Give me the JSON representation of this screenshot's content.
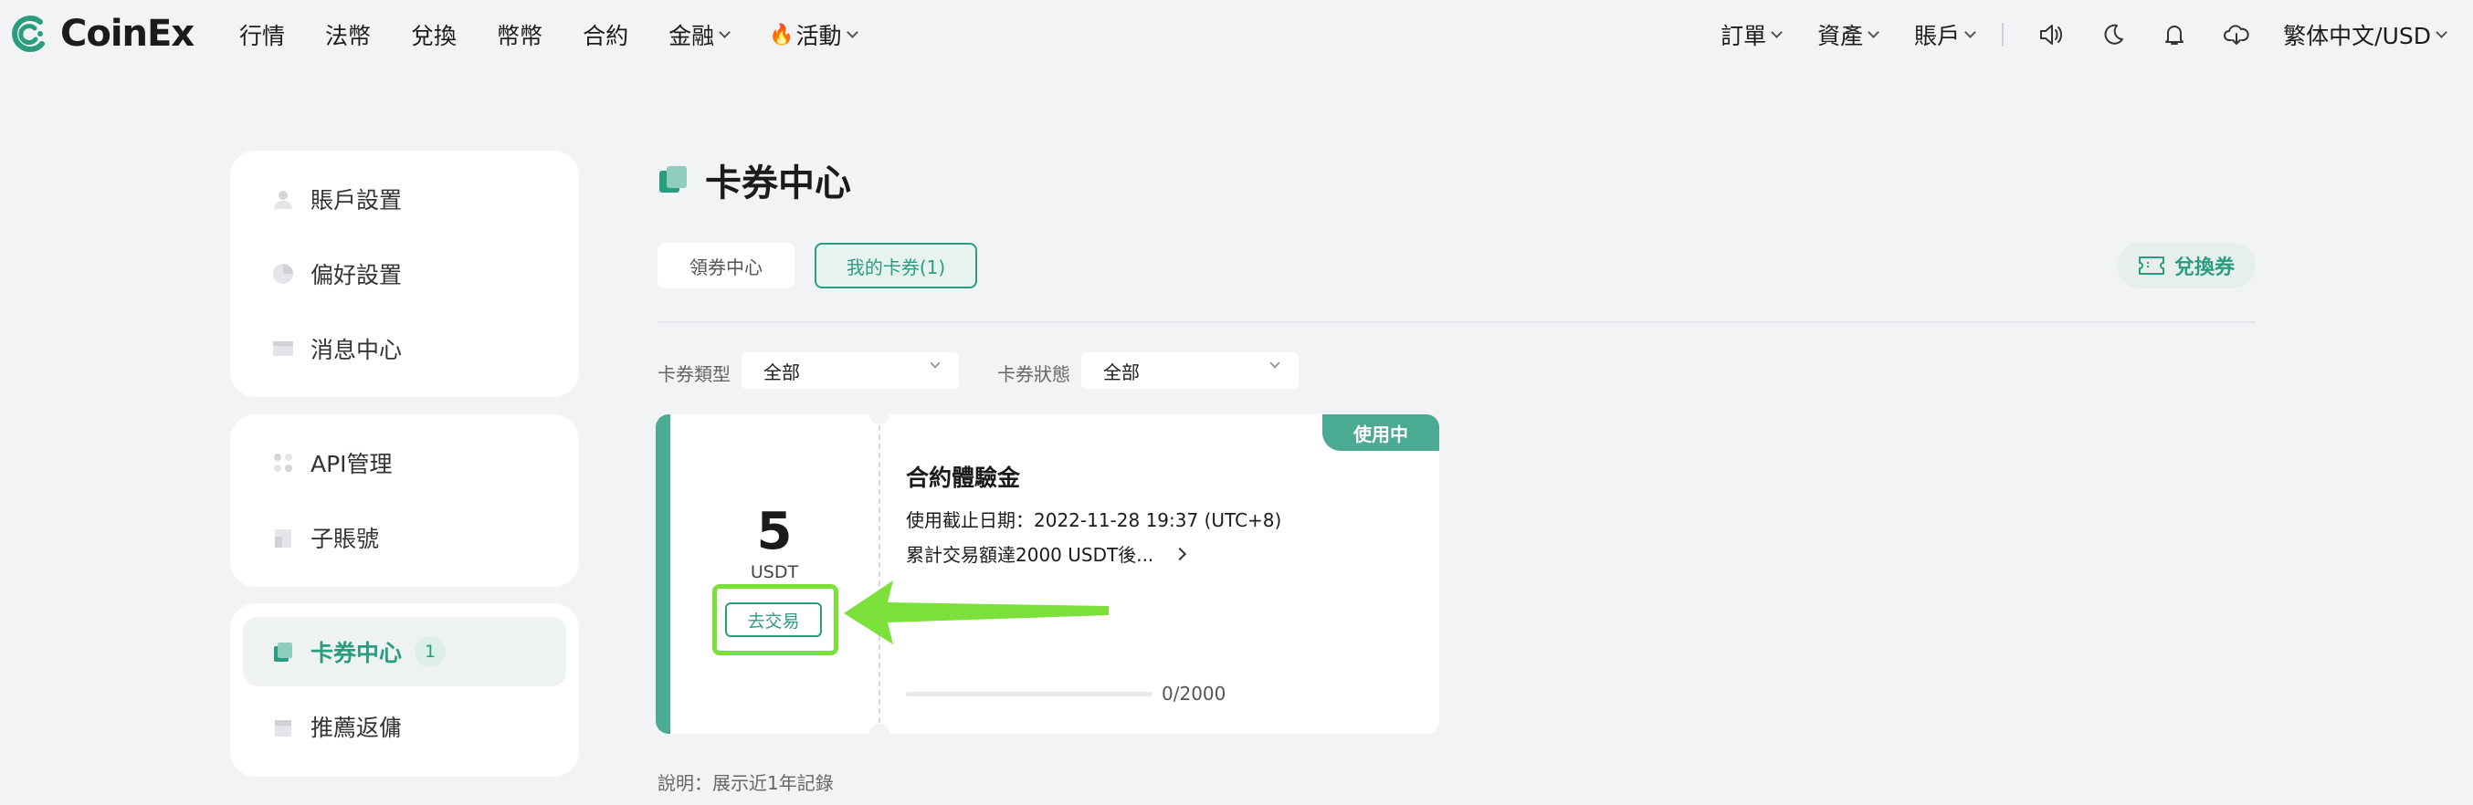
{
  "brand": {
    "name": "CoinEx",
    "accent": "#2a9d80",
    "highlight": "#7be03a"
  },
  "nav": {
    "main": [
      {
        "label": "行情"
      },
      {
        "label": "法幣"
      },
      {
        "label": "兌換"
      },
      {
        "label": "幣幣"
      },
      {
        "label": "合約"
      },
      {
        "label": "金融"
      },
      {
        "label": "活動"
      }
    ],
    "right": [
      {
        "label": "訂單"
      },
      {
        "label": "資產"
      },
      {
        "label": "賬戶"
      }
    ],
    "icons": [
      "sound-icon",
      "moon-icon",
      "bell-icon",
      "download-icon"
    ],
    "language": "繁体中文/USD"
  },
  "sidebar": {
    "group1": [
      {
        "label": "賬戶設置",
        "icon": "user-icon"
      },
      {
        "label": "偏好設置",
        "icon": "preferences-icon"
      },
      {
        "label": "消息中心",
        "icon": "message-icon"
      }
    ],
    "group2": [
      {
        "label": "API管理",
        "icon": "api-icon"
      },
      {
        "label": "子賬號",
        "icon": "sub-account-icon"
      }
    ],
    "group3": [
      {
        "label": "卡券中心",
        "icon": "coupon-icon",
        "badge": "1"
      },
      {
        "label": "推薦返傭",
        "icon": "referral-icon"
      }
    ]
  },
  "main": {
    "title": "卡券中心",
    "tabs": [
      {
        "label": "領券中心"
      },
      {
        "label": "我的卡券(1)"
      }
    ],
    "redeem_label": "兌換券",
    "filters": {
      "type_label": "卡券類型",
      "type_value": "全部",
      "status_label": "卡券狀態",
      "status_value": "全部"
    },
    "coupon": {
      "amount": "5",
      "unit": "USDT",
      "trade_label": "去交易",
      "status": "使用中",
      "title": "合約體驗金",
      "expiry": "使用截止日期：2022-11-28 19:37 (UTC+8)",
      "condition": "累計交易額達2000 USDT後...",
      "progress_value": 0,
      "progress_max": 2000,
      "progress_text": "0/2000"
    },
    "note": "說明：展示近1年記錄"
  }
}
